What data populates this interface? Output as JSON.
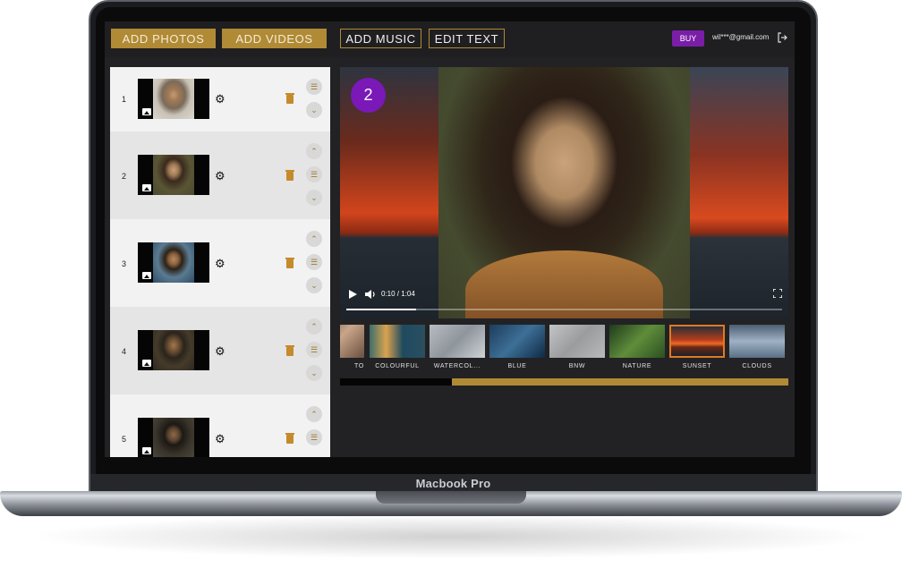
{
  "device": {
    "label": "Macbook Pro"
  },
  "toolbar": {
    "add_photos": "ADD PHOTOS",
    "add_videos": "ADD VIDEOS",
    "add_music": "ADD MUSIC",
    "edit_text": "EDIT TEXT",
    "buy": "BUY",
    "email": "wil***@gmail.com",
    "logout_icon": "logout-icon"
  },
  "slides": [
    {
      "number": "1",
      "controls": [
        "delete-icon",
        "reorder-icon",
        "chevron-down-icon"
      ]
    },
    {
      "number": "2",
      "controls": [
        "chevron-up-icon",
        "delete-icon",
        "reorder-icon",
        "chevron-down-icon"
      ]
    },
    {
      "number": "3",
      "controls": [
        "chevron-up-icon",
        "delete-icon",
        "reorder-icon",
        "chevron-down-icon"
      ]
    },
    {
      "number": "4",
      "controls": [
        "chevron-up-icon",
        "delete-icon",
        "reorder-icon",
        "chevron-down-icon"
      ]
    },
    {
      "number": "5",
      "controls": [
        "chevron-up-icon",
        "delete-icon",
        "reorder-icon"
      ]
    }
  ],
  "player": {
    "badge": "2",
    "current_time": "0:10",
    "duration": "1:04",
    "time_display": "0:10 / 1:04",
    "progress": 0.16
  },
  "filters": [
    {
      "label": "TO",
      "selected": false
    },
    {
      "label": "COLOURFUL",
      "selected": false
    },
    {
      "label": "WATERCOL...",
      "selected": false
    },
    {
      "label": "BLUE",
      "selected": false
    },
    {
      "label": "BNW",
      "selected": false
    },
    {
      "label": "NATURE",
      "selected": false
    },
    {
      "label": "SUNSET",
      "selected": true
    },
    {
      "label": "CLOUDS",
      "selected": false
    }
  ],
  "timeline": {
    "progress": 0.25
  },
  "colors": {
    "accent_gold": "#b08a35",
    "buy_purple": "#7a1ea8",
    "selected_filter": "#e07a22"
  }
}
